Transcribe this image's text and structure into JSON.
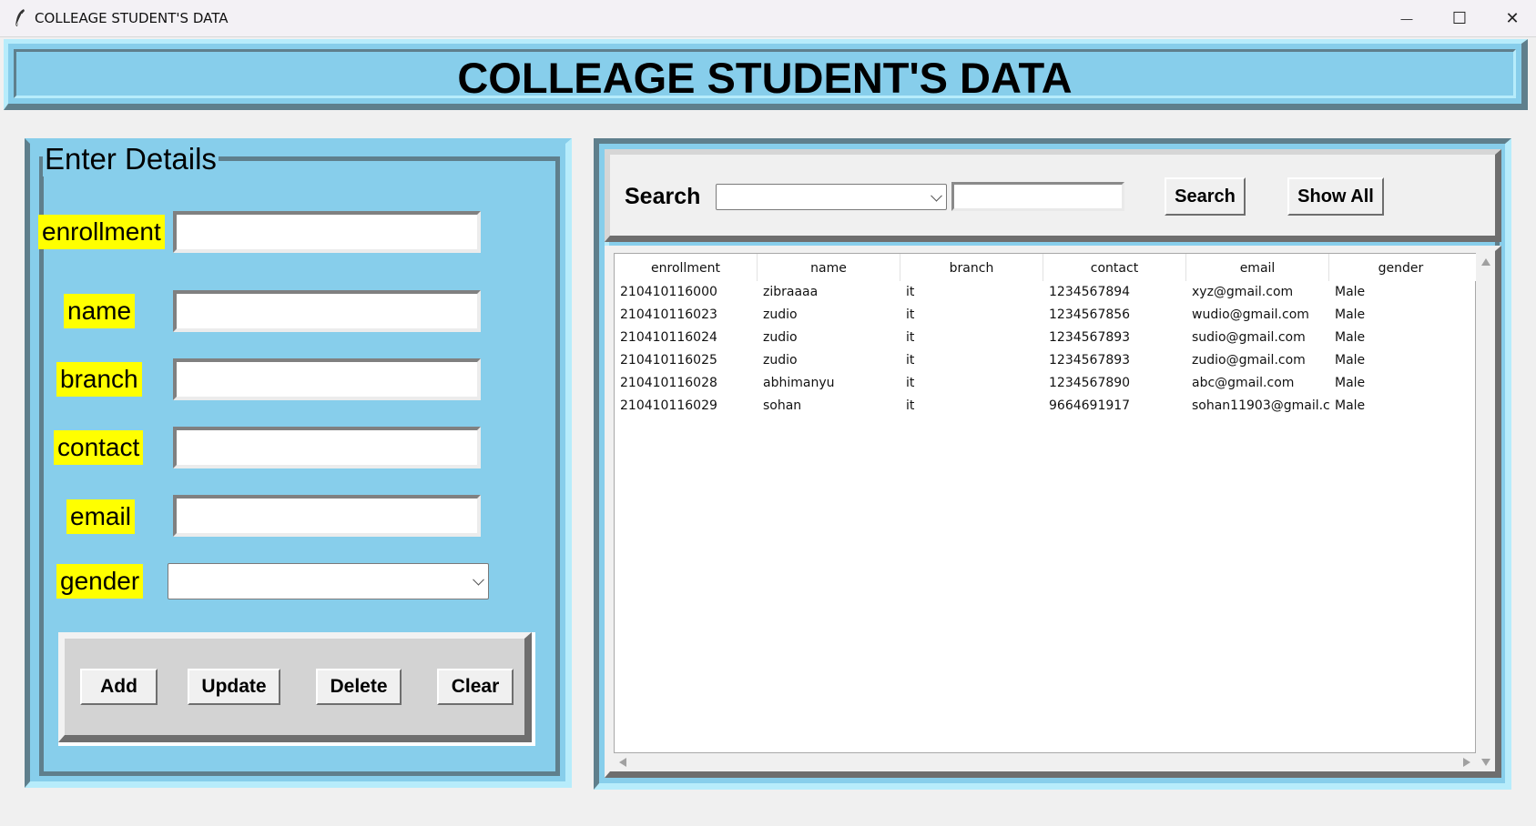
{
  "window": {
    "title": "COLLEAGE STUDENT'S DATA",
    "minimize_glyph": "—",
    "maximize_glyph": "☐",
    "close_glyph": "✕"
  },
  "header": {
    "title": "COLLEAGE STUDENT'S DATA"
  },
  "form": {
    "title": "Enter Details",
    "fields": {
      "enrollment": {
        "label": "enrollment",
        "value": ""
      },
      "name": {
        "label": "name",
        "value": ""
      },
      "branch": {
        "label": "branch",
        "value": ""
      },
      "contact": {
        "label": "contact",
        "value": ""
      },
      "email": {
        "label": "email",
        "value": ""
      },
      "gender": {
        "label": "gender",
        "value": ""
      }
    },
    "buttons": {
      "add": "Add",
      "update": "Update",
      "delete": "Delete",
      "clear": "Clear"
    }
  },
  "search": {
    "label": "Search",
    "by_value": "",
    "text_value": "",
    "search_button": "Search",
    "show_all_button": "Show All"
  },
  "table": {
    "columns": [
      "enrollment",
      "name",
      "branch",
      "contact",
      "email",
      "gender"
    ],
    "rows": [
      [
        "210410116000",
        "zibraaaa",
        "it",
        "1234567894",
        "xyz@gmail.com",
        "Male"
      ],
      [
        "210410116023",
        "zudio",
        "it",
        "1234567856",
        "wudio@gmail.com",
        "Male"
      ],
      [
        "210410116024",
        "zudio",
        "it",
        "1234567893",
        "sudio@gmail.com",
        "Male"
      ],
      [
        "210410116025",
        "zudio",
        "it",
        "1234567893",
        "zudio@gmail.com",
        "Male"
      ],
      [
        "210410116028",
        "abhimanyu",
        "it",
        "1234567890",
        "abc@gmail.com",
        "Male"
      ],
      [
        "210410116029",
        "sohan",
        "it",
        "9664691917",
        "sohan11903@gmail.co",
        "Male"
      ]
    ]
  },
  "colors": {
    "panel": "#87ceeb",
    "label_bg": "#ffff00",
    "window_bg": "#f0f0f0"
  }
}
